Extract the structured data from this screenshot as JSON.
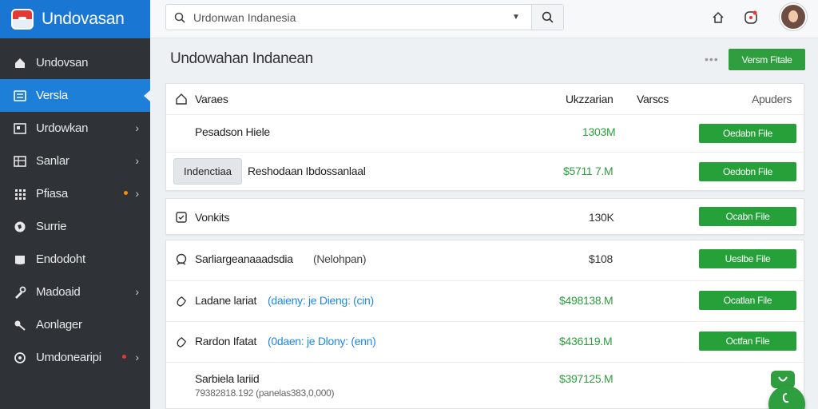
{
  "app": {
    "title": "Undovasan"
  },
  "sidebar": {
    "items": [
      {
        "label": "Undovsan",
        "icon": "home-icon"
      },
      {
        "label": "Versla",
        "icon": "list-icon"
      },
      {
        "label": "Urdowkan",
        "icon": "grid-icon"
      },
      {
        "label": "Sanlar",
        "icon": "table-icon"
      },
      {
        "label": "Pfiasa",
        "icon": "apps-icon"
      },
      {
        "label": "Surrie",
        "icon": "globe-icon"
      },
      {
        "label": "Endodoht",
        "icon": "folder-icon"
      },
      {
        "label": "Madoaid",
        "icon": "wrench-icon"
      },
      {
        "label": "Aonlager",
        "icon": "key-icon"
      },
      {
        "label": "Umdonearipi",
        "icon": "settings-icon"
      }
    ]
  },
  "search": {
    "placeholder": "Urdonwan Indanesia"
  },
  "main": {
    "title": "Undowahan Indanean",
    "primary_button": "Versm Fitale"
  },
  "table": {
    "headers": {
      "name": "Varaes",
      "col1": "Ukzzarian",
      "col2": "Varscs",
      "col3": "Apuders"
    },
    "rows": [
      {
        "name": "Pesadson Hiele",
        "amount": "1303M",
        "button": "Oedabn File"
      },
      {
        "tag": "Indenctiaa",
        "name": "Reshodaan Ibdossanlaal",
        "amount": "$5711 7.M",
        "button": "Oedobn File"
      }
    ]
  },
  "card2": {
    "name": "Vonkits",
    "amount": "130K",
    "button": "Ocabn File"
  },
  "card3": {
    "rows": [
      {
        "name": "Sarliargeanaaadsdia",
        "extra": "(Nelohpan)",
        "amount": "$108",
        "button": "Ueslbe File"
      },
      {
        "name": "Ladane lariat",
        "link": "(daieny: je Dieng: (cin)",
        "amount": "$498138.M",
        "button": "Ocatlan File"
      },
      {
        "name": "Rardon Ifatat",
        "link": "(0daen: je Dlony: (enn)",
        "amount": "$436119.M",
        "button": "Octfan File"
      },
      {
        "name": "Sarbiela lariid",
        "sub": "79382818.192 (panelas383,0,000)",
        "amount": "$397125.M"
      }
    ]
  },
  "colors": {
    "accent": "#1976d2",
    "success": "#2e9e3e",
    "sidebar": "#2f3337"
  }
}
